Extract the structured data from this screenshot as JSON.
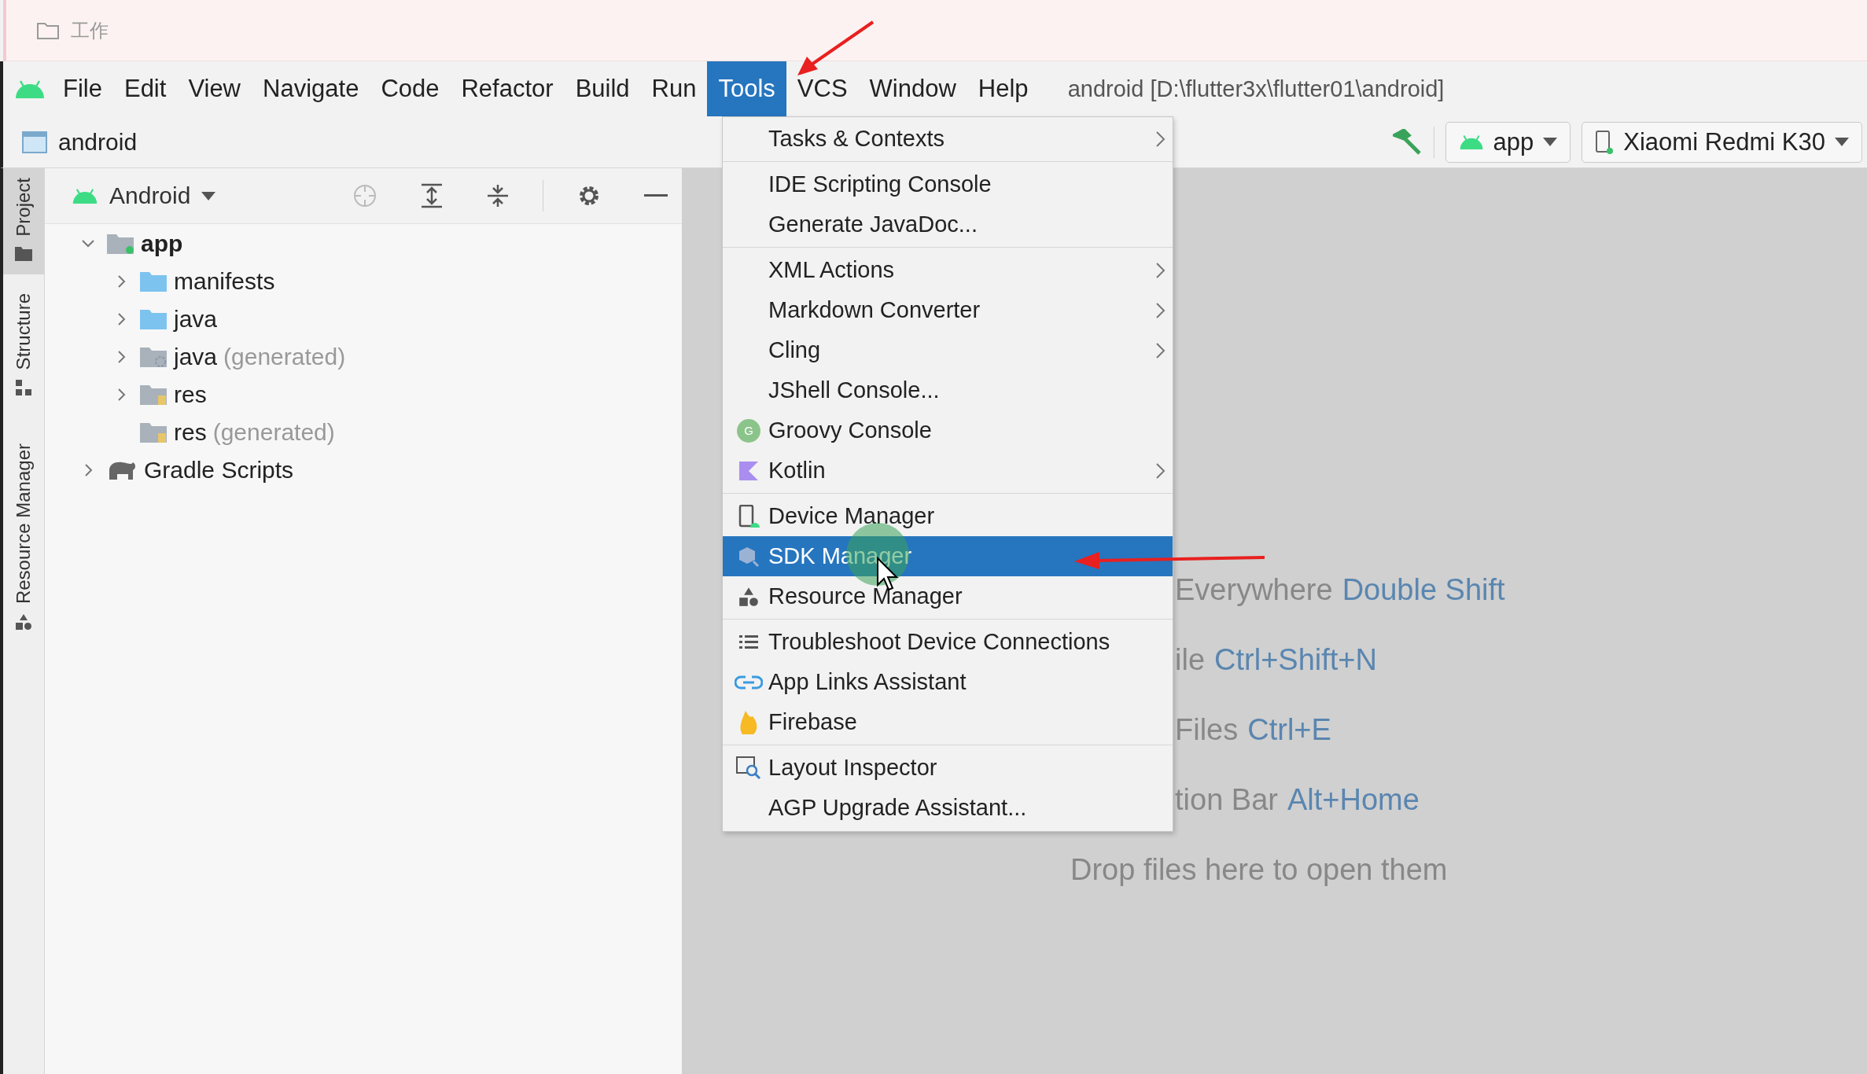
{
  "top_strip": {
    "folder": "工作"
  },
  "menu_bar": {
    "items": [
      {
        "label": "File",
        "selected": false
      },
      {
        "label": "Edit",
        "selected": false
      },
      {
        "label": "View",
        "selected": false
      },
      {
        "label": "Navigate",
        "selected": false
      },
      {
        "label": "Code",
        "selected": false
      },
      {
        "label": "Refactor",
        "selected": false
      },
      {
        "label": "Build",
        "selected": false
      },
      {
        "label": "Run",
        "selected": false
      },
      {
        "label": "Tools",
        "selected": true
      },
      {
        "label": "VCS",
        "selected": false
      },
      {
        "label": "Window",
        "selected": false
      },
      {
        "label": "Help",
        "selected": false
      }
    ],
    "project_title": "android [D:\\flutter3x\\flutter01\\android]"
  },
  "nav_bar": {
    "breadcrumb": "android",
    "run_config": "app",
    "device": "Xiaomi Redmi K30"
  },
  "tool_strip": [
    {
      "label": "Project",
      "selected": true,
      "kind": "project"
    },
    {
      "label": "Structure",
      "selected": false,
      "kind": "structure"
    },
    {
      "label": "Resource Manager",
      "selected": false,
      "kind": "resource"
    }
  ],
  "project_panel": {
    "view": "Android",
    "tree": [
      {
        "label": "app",
        "kind": "module",
        "expanded": true,
        "children": [
          {
            "label": "manifests",
            "kind": "folder",
            "expanded": false
          },
          {
            "label": "java",
            "kind": "folder",
            "expanded": false
          },
          {
            "label": "java",
            "suffix": "(generated)",
            "kind": "generated",
            "expanded": false
          },
          {
            "label": "res",
            "kind": "res",
            "expanded": false
          },
          {
            "label": "res",
            "suffix": "(generated)",
            "kind": "res"
          }
        ]
      },
      {
        "label": "Gradle Scripts",
        "kind": "gradle",
        "expanded": false
      }
    ]
  },
  "tools_menu": {
    "groups": [
      [
        {
          "label": "Tasks & Contexts",
          "kind": "plain",
          "submenu": true,
          "selected": false
        }
      ],
      [
        {
          "label": "IDE Scripting Console",
          "kind": "plain",
          "submenu": false,
          "selected": false
        },
        {
          "label": "Generate JavaDoc...",
          "kind": "plain",
          "submenu": false,
          "selected": false
        }
      ],
      [
        {
          "label": "XML Actions",
          "kind": "plain",
          "submenu": true,
          "selected": false
        },
        {
          "label": "Markdown Converter",
          "kind": "plain",
          "submenu": true,
          "selected": false
        },
        {
          "label": "Cling",
          "kind": "plain",
          "submenu": true,
          "selected": false
        },
        {
          "label": "JShell Console...",
          "kind": "plain",
          "submenu": false,
          "selected": false
        },
        {
          "label": "Groovy Console",
          "kind": "groovy",
          "icon_letter": "G",
          "submenu": false,
          "selected": false
        },
        {
          "label": "Kotlin",
          "kind": "kotlin",
          "submenu": true,
          "selected": false
        }
      ],
      [
        {
          "label": "Device Manager",
          "kind": "device",
          "submenu": false,
          "selected": false
        },
        {
          "label": "SDK Manager",
          "kind": "sdk",
          "submenu": false,
          "selected": true
        },
        {
          "label": "Resource Manager",
          "kind": "resource",
          "submenu": false,
          "selected": false
        }
      ],
      [
        {
          "label": "Troubleshoot Device Connections",
          "kind": "list",
          "submenu": false,
          "selected": false
        },
        {
          "label": "App Links Assistant",
          "kind": "link",
          "submenu": false,
          "selected": false
        },
        {
          "label": "Firebase",
          "kind": "firebase",
          "submenu": false,
          "selected": false
        }
      ],
      [
        {
          "label": "Layout Inspector",
          "kind": "layout",
          "submenu": false,
          "selected": false
        },
        {
          "label": "AGP Upgrade Assistant...",
          "kind": "plain",
          "submenu": false,
          "selected": false
        }
      ]
    ]
  },
  "editor_hints": [
    {
      "action": "Everywhere",
      "shortcut": "Double Shift"
    },
    {
      "action": "ile",
      "shortcut": "Ctrl+Shift+N"
    },
    {
      "action": "Files",
      "shortcut": "Ctrl+E"
    },
    {
      "action": "tion Bar",
      "shortcut": "Alt+Home"
    }
  ],
  "drop_hint": "Drop files here to open them"
}
